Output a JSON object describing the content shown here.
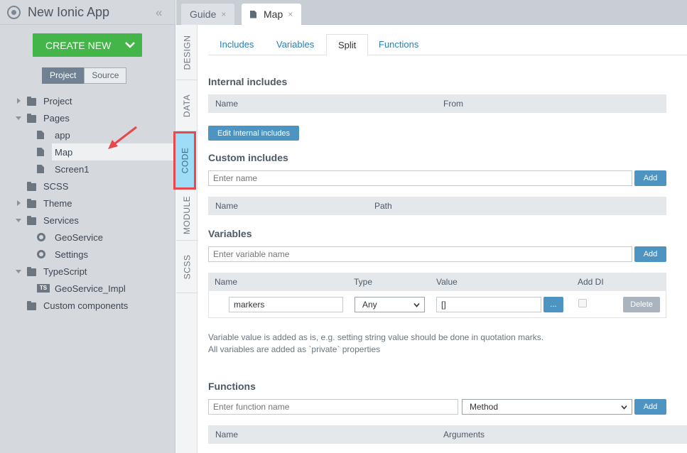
{
  "app": {
    "title": "New Ionic App",
    "collapse": "«"
  },
  "sidebar": {
    "create_label": "CREATE NEW",
    "seg_project": "Project",
    "seg_source": "Source",
    "tree": [
      {
        "label": "Project",
        "icon": "folder-icon",
        "expand": "collapsed",
        "indent": 0
      },
      {
        "label": "Pages",
        "icon": "folder-icon",
        "expand": "expanded",
        "indent": 0
      },
      {
        "label": "app",
        "icon": "file-icon",
        "expand": "none",
        "indent": 1
      },
      {
        "label": "Map",
        "icon": "file-icon",
        "expand": "none",
        "indent": 1,
        "selected": true
      },
      {
        "label": "Screen1",
        "icon": "file-icon",
        "expand": "none",
        "indent": 1
      },
      {
        "label": "SCSS",
        "icon": "folder-icon",
        "expand": "none",
        "indent": 0
      },
      {
        "label": "Theme",
        "icon": "folder-icon",
        "expand": "collapsed",
        "indent": 0
      },
      {
        "label": "Services",
        "icon": "folder-icon",
        "expand": "expanded",
        "indent": 0
      },
      {
        "label": "GeoService",
        "icon": "gear-icon",
        "expand": "none",
        "indent": 1
      },
      {
        "label": "Settings",
        "icon": "gear-icon",
        "expand": "none",
        "indent": 1
      },
      {
        "label": "TypeScript",
        "icon": "folder-icon",
        "expand": "expanded",
        "indent": 0
      },
      {
        "label": "GeoService_Impl",
        "icon": "ts-icon",
        "ts_text": "TS",
        "expand": "none",
        "indent": 1
      },
      {
        "label": "Custom components",
        "icon": "folder-icon",
        "expand": "none",
        "indent": 0
      }
    ]
  },
  "tabs": {
    "guide": "Guide",
    "map": "Map",
    "close": "×"
  },
  "vtabs": {
    "design": "DESIGN",
    "data": "DATA",
    "code": "CODE",
    "module": "MODULE",
    "scss": "SCSS"
  },
  "subtabs": {
    "includes": "Includes",
    "variables": "Variables",
    "split": "Split",
    "functions": "Functions"
  },
  "internal": {
    "heading": "Internal includes",
    "col_name": "Name",
    "col_from": "From",
    "edit_button": "Edit Internal includes"
  },
  "custom": {
    "heading": "Custom includes",
    "placeholder": "Enter name",
    "add": "Add",
    "col_name": "Name",
    "col_path": "Path"
  },
  "variables": {
    "heading": "Variables",
    "placeholder": "Enter variable name",
    "add": "Add",
    "col_name": "Name",
    "col_type": "Type",
    "col_value": "Value",
    "col_adddi": "Add DI",
    "row": {
      "name": "markers",
      "type": "Any",
      "value": "[]",
      "more": "...",
      "delete": "Delete"
    },
    "note1": "Variable value is added as is, e.g. setting string value should be done in quotation marks.",
    "note2": "All variables are added as `private` properties"
  },
  "functions": {
    "heading": "Functions",
    "placeholder": "Enter function name",
    "method": "Method",
    "add": "Add",
    "col_name": "Name",
    "col_args": "Arguments"
  },
  "colors": {
    "create_green": "#44b649",
    "accent_blue": "#4d94c3",
    "highlight_red": "#e8474b",
    "code_tab": "#9fdcf6"
  }
}
